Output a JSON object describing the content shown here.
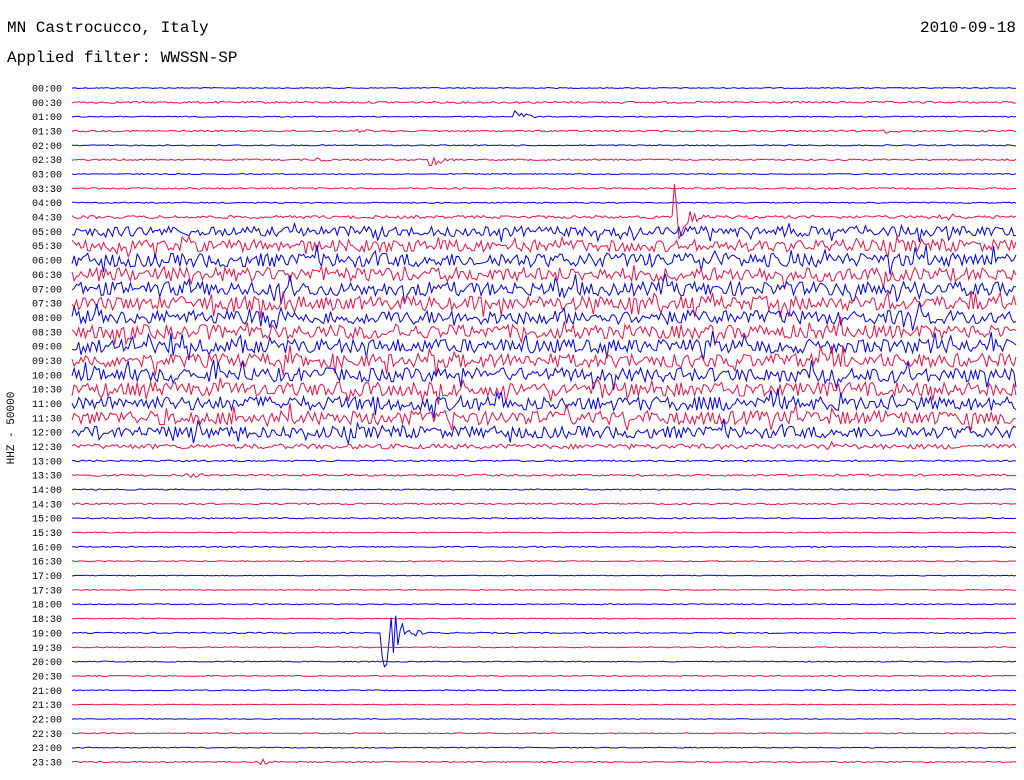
{
  "header": {
    "station": "MN Castrocucco, Italy",
    "date": "2010-09-18",
    "filter": "Applied filter: WWSSN-SP"
  },
  "chart_data": {
    "type": "line",
    "title": "MN Castrocucco, Italy",
    "ylabel": "HHZ - 50000",
    "row_labels": [
      "00:00",
      "00:30",
      "01:00",
      "01:30",
      "02:00",
      "02:30",
      "03:00",
      "03:30",
      "04:00",
      "04:30",
      "05:00",
      "05:30",
      "06:00",
      "06:30",
      "07:00",
      "07:30",
      "08:00",
      "08:30",
      "09:00",
      "09:30",
      "10:00",
      "10:30",
      "11:00",
      "11:30",
      "12:00",
      "12:30",
      "13:00",
      "13:30",
      "14:00",
      "14:30",
      "15:00",
      "15:30",
      "16:00",
      "16:30",
      "17:00",
      "17:30",
      "18:00",
      "18:30",
      "19:00",
      "19:30",
      "20:00",
      "20:30",
      "21:00",
      "21:30",
      "22:00",
      "22:30",
      "23:00",
      "23:30"
    ],
    "colors": [
      "#0000ee",
      "#ee1144"
    ],
    "noise_levels": [
      0.5,
      1.0,
      0.5,
      0.8,
      0.6,
      0.8,
      0.5,
      0.8,
      0.6,
      1.5,
      5,
      6,
      7,
      7,
      7,
      7,
      7,
      7,
      7,
      7,
      7,
      7,
      7,
      7,
      6,
      2.5,
      0.8,
      1.0,
      0.6,
      0.8,
      0.6,
      0.5,
      0.6,
      0.5,
      0.4,
      0.4,
      0.5,
      0.5,
      0.6,
      0.5,
      0.5,
      0.5,
      0.5,
      0.4,
      0.4,
      0.5,
      0.5,
      0.6
    ],
    "events": [
      {
        "row": 2,
        "t": 0.47,
        "amp": 7
      },
      {
        "row": 3,
        "t": 0.3,
        "amp": 3
      },
      {
        "row": 3,
        "t": 0.86,
        "amp": 3
      },
      {
        "row": 5,
        "t": 0.26,
        "amp": 3
      },
      {
        "row": 5,
        "t": 0.38,
        "amp": 10
      },
      {
        "row": 9,
        "t": 0.64,
        "amp": 35
      },
      {
        "row": 9,
        "t": 0.92,
        "amp": 6
      },
      {
        "row": 25,
        "t": 0.8,
        "amp": 4
      },
      {
        "row": 27,
        "t": 0.12,
        "amp": 3
      },
      {
        "row": 38,
        "t": 0.33,
        "amp": 60
      },
      {
        "row": 47,
        "t": 0.2,
        "amp": 3
      }
    ]
  }
}
